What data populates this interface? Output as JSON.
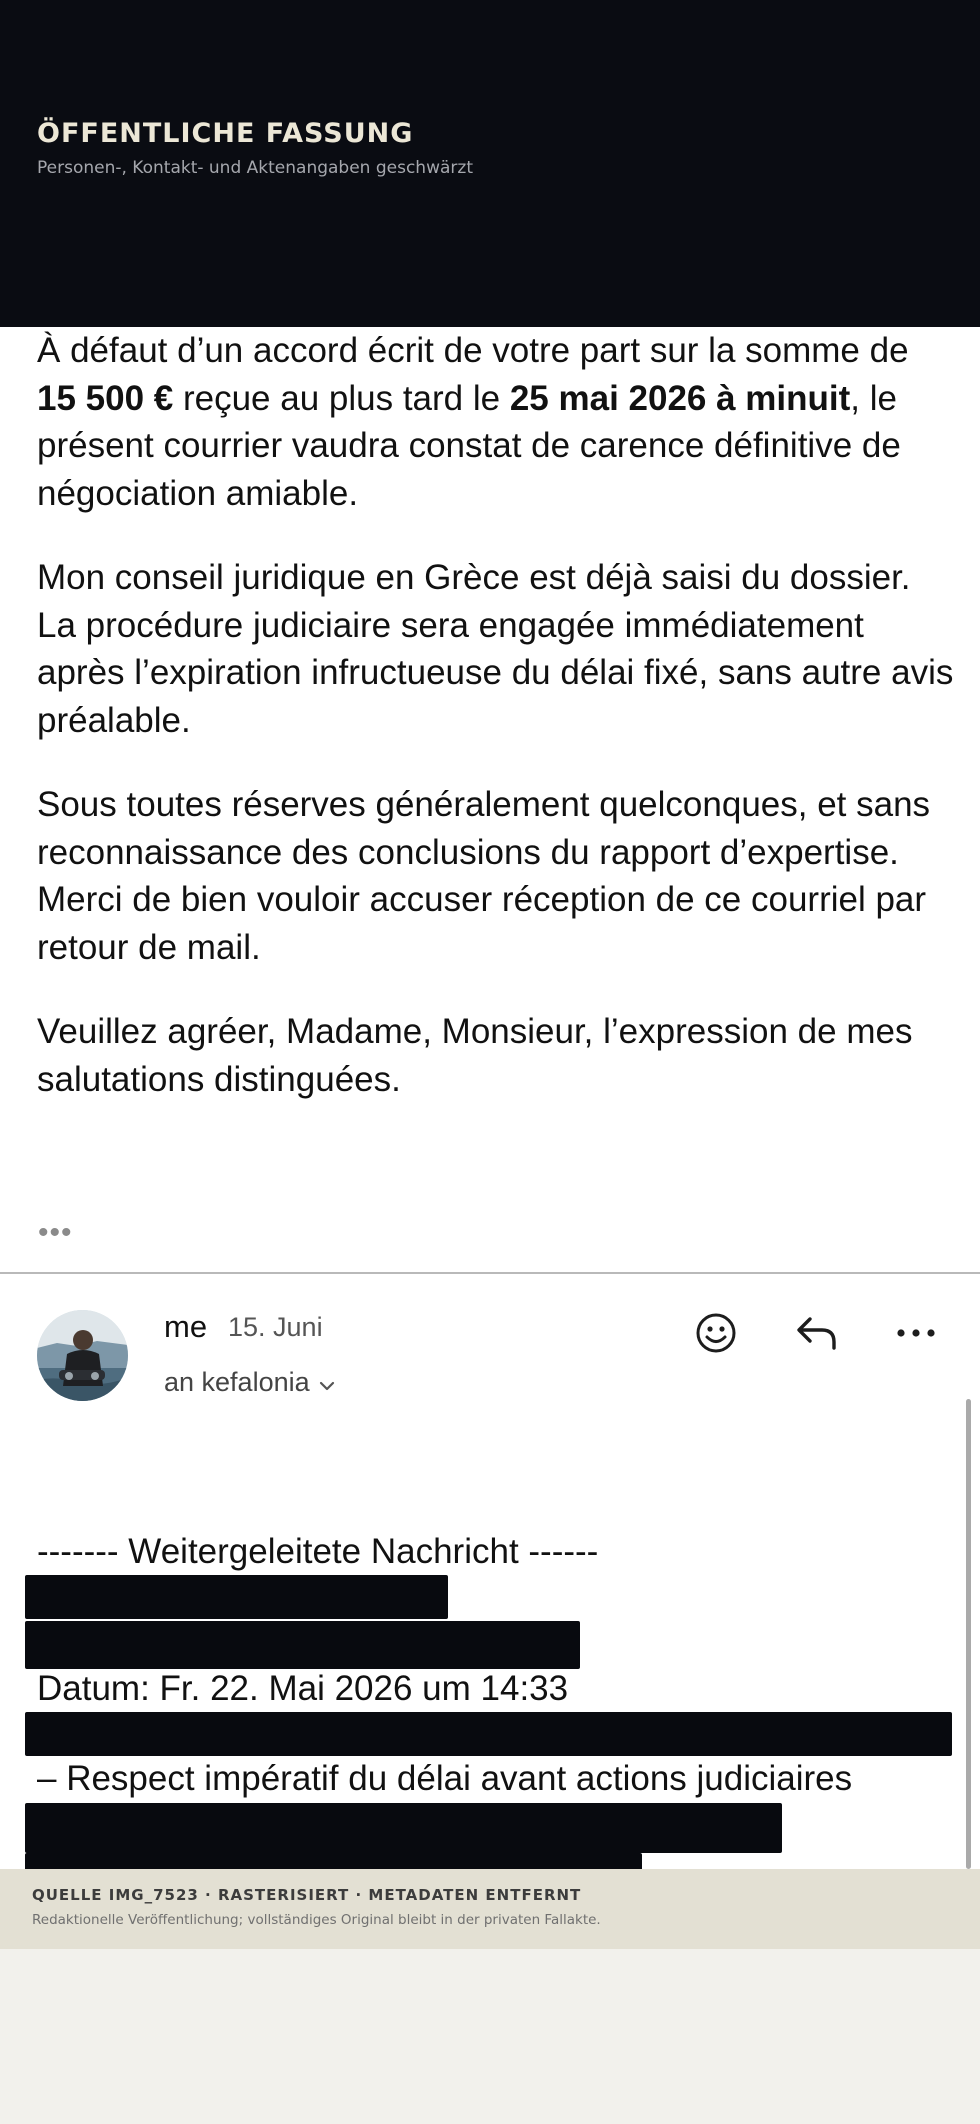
{
  "header": {
    "title": "ÖFFENTLICHE FASSUNG",
    "subtitle": "Personen-, Kontakt- und Aktenangaben geschwärzt"
  },
  "message": {
    "p1_a": "À défaut d’un accord écrit de votre part sur la somme de ",
    "p1_amount": "15 500 €",
    "p1_b": " reçue au plus tard le ",
    "p1_deadline": "25 mai 2026 à minuit",
    "p1_c": ", le présent courrier vaudra constat de carence définitive de négociation amiable.",
    "p2": "Mon conseil juridique en Grèce est déjà saisi du dossier. La procédure judiciaire sera engagée immédiatement après l’expiration infructueuse du délai fixé, sans autre avis préalable.",
    "p3_line1": "Sous toutes réserves généralement quelconques, et sans reconnaissance des conclusions du rapport d’expertise.",
    "p3_line2": "Merci de bien vouloir accuser réception de ce courriel par retour de mail.",
    "p4": "Veuillez agréer, Madame, Monsieur, l’expression de mes salutations distinguées.",
    "more_dots": "•••"
  },
  "reply": {
    "sender": "me",
    "date": "15. Juni",
    "to": "an kefalonia",
    "icons": [
      "smiley-icon",
      "reply-icon",
      "more-icon"
    ],
    "forward_header": "------- Weitergeleitete Nachricht ------",
    "date_line": "Datum: Fr. 22. Mai 2026 um 14:33",
    "subject_line": "– Respect impératif du délai avant actions judiciaires"
  },
  "footer": {
    "title": "QUELLE IMG_7523 · RASTERISIERT · METADATEN ENTFERNT",
    "subtitle": "Redaktionelle Veröffentlichung; vollständiges Original bleibt in der privaten Fallakte."
  },
  "colors": {
    "header_bg": "#0a0c12",
    "redaction": "#080a0f",
    "footer_bg": "#e3e0d3",
    "page_bg": "#f2f1ec"
  }
}
